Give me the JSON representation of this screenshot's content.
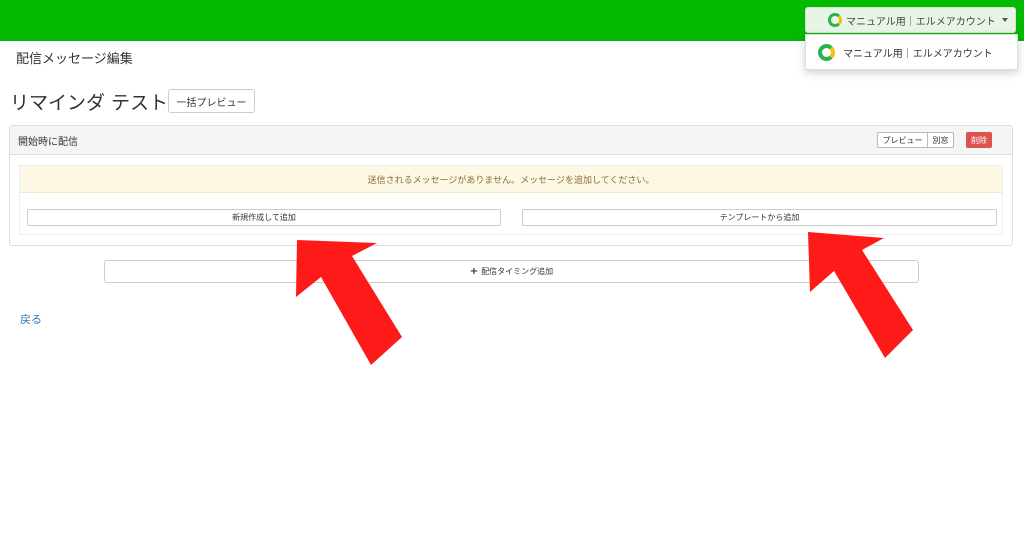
{
  "header": {
    "account_label": "マニュアル用｜エルメアカウント",
    "dropdown_item": "マニュアル用｜エルメアカウント"
  },
  "breadcrumb": "配信メッセージ編集",
  "page": {
    "title": "リマインダ テスト",
    "preview_all_label": "一括プレビュー"
  },
  "panel": {
    "title": "開始時に配信",
    "preview_label": "プレビュー",
    "separate_window_label": "別窓",
    "delete_label": "削除",
    "empty_message": "送信されるメッセージがありません。メッセージを追加してください。",
    "new_create_label": "新規作成して追加",
    "template_label": "テンプレートから追加"
  },
  "add_timing_label": "配信タイミング追加",
  "back_label": "戻る",
  "colors": {
    "brand": "#00b900",
    "danger": "#d9534f",
    "warning_bg": "#fcf8e3",
    "arrow": "#ff1a1a"
  }
}
